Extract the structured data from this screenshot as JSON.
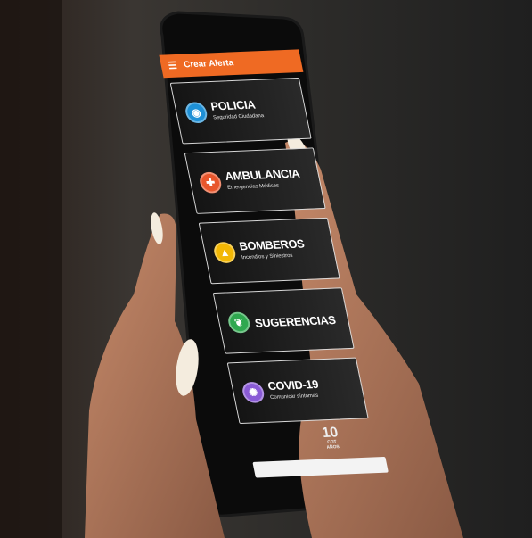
{
  "app": {
    "title": "Crear Alerta",
    "menu_icon": "hamburger-menu-icon",
    "accent_color": "#ef6a23"
  },
  "items": [
    {
      "label": "POLICIA",
      "sublabel": "Seguridad Ciudadana",
      "icon": "police-icon",
      "color": "#1e90d6"
    },
    {
      "label": "AMBULANCIA",
      "sublabel": "Emergencias Médicas",
      "icon": "medical-cross-icon",
      "color": "#e8562c"
    },
    {
      "label": "BOMBEROS",
      "sublabel": "Incendios y Siniestros",
      "icon": "fire-icon",
      "color": "#f2b705"
    },
    {
      "label": "SUGERENCIAS",
      "sublabel": "",
      "icon": "leaf-icon",
      "color": "#2fa84f"
    },
    {
      "label": "COVID-19",
      "sublabel": "Comunicar síntomas",
      "icon": "virus-icon",
      "color": "#8a5bd6"
    }
  ],
  "logo": {
    "big": "10",
    "mid": "COT",
    "small": "AÑOS"
  }
}
